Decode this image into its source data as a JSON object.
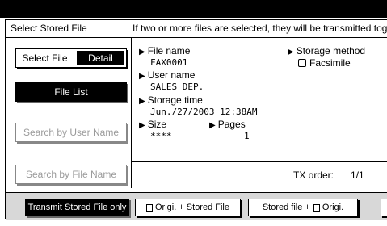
{
  "header": {
    "title": "Select Stored File",
    "info": "If two or more files are selected, they will be transmitted toge"
  },
  "view_toggle": {
    "select_file_label": "Select File",
    "detail_label": "Detail"
  },
  "left_buttons": {
    "file_list": "File List",
    "search_user": "Search by User Name",
    "search_file": "Search by File Name"
  },
  "details": {
    "file_name_label": "File name",
    "file_name_value": "FAX0001",
    "storage_method_label": "Storage method",
    "storage_method_value": "Facsimile",
    "user_name_label": "User name",
    "user_name_value": "SALES DEP.",
    "storage_time_label": "Storage time",
    "storage_time_value": "Jun./27/2003 12:38AM",
    "size_label": "Size",
    "size_value": "****",
    "pages_label": "Pages",
    "pages_value": "1"
  },
  "tx_order": {
    "label": "TX order:",
    "value": "1/1"
  },
  "bottom_buttons": {
    "transmit_only": "Transmit Stored File only",
    "orig_plus_stored": "Origi. + Stored File",
    "stored_plus_orig": "Stored file +",
    "stored_plus_orig_tail": "Origi."
  },
  "icons": [
    "triangle-right-icon",
    "fax-icon",
    "document-icon"
  ]
}
